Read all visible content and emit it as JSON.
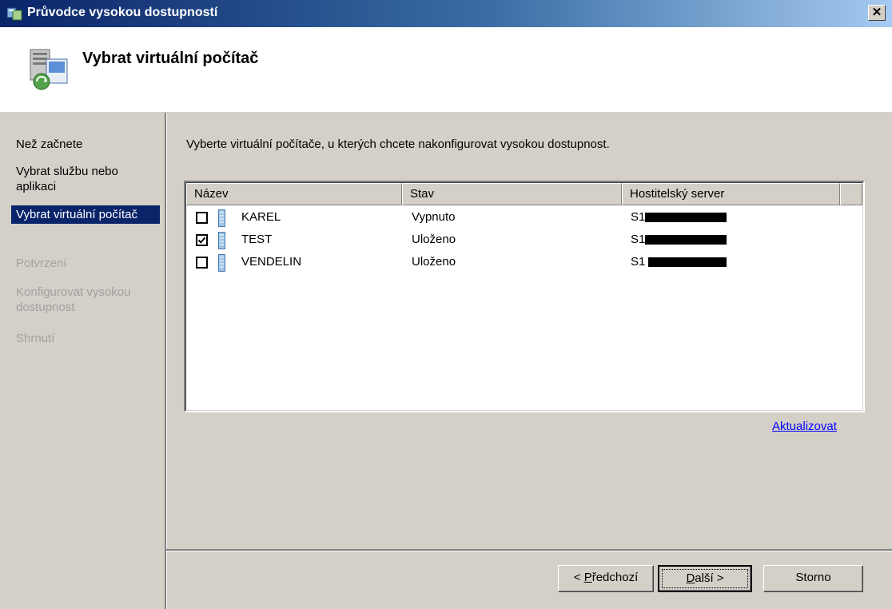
{
  "window": {
    "title": "Průvodce vysokou dostupností",
    "close_glyph": "✕"
  },
  "header": {
    "title": "Vybrat virtuální počítač"
  },
  "sidebar": {
    "steps": [
      {
        "label": "Než začnete",
        "state": "normal"
      },
      {
        "label": "Vybrat službu nebo aplikaci",
        "state": "normal"
      },
      {
        "label": "Vybrat virtuální počítač",
        "state": "active"
      },
      {
        "label": "Potvrzení",
        "state": "disabled"
      },
      {
        "label": "Konfigurovat vysokou dostupnost",
        "state": "disabled"
      },
      {
        "label": "Shrnutí",
        "state": "disabled"
      }
    ]
  },
  "main": {
    "instruction": "Vyberte virtuální počítače, u kterých chcete nakonfigurovat vysokou dostupnost.",
    "table": {
      "columns": [
        "Název",
        "Stav",
        "Hostitelský server"
      ],
      "rows": [
        {
          "checked": false,
          "name": "KAREL",
          "status": "Vypnuto",
          "host": "S1"
        },
        {
          "checked": true,
          "name": "TEST",
          "status": "Uloženo",
          "host": "S1"
        },
        {
          "checked": false,
          "name": "VENDELIN",
          "status": "Uloženo",
          "host": "S1"
        }
      ]
    },
    "refresh_link": "Aktualizovat"
  },
  "footer": {
    "back_prefix": "< ",
    "back_mnemonic": "P",
    "back_rest": "ředchozí",
    "next_mnemonic": "D",
    "next_rest": "alší >",
    "cancel_label": "Storno"
  },
  "colors": {
    "titlebar_start": "#0a246a",
    "selection": "#0a246a",
    "link": "#0000ff",
    "disabled_text": "#a0a0a0"
  }
}
